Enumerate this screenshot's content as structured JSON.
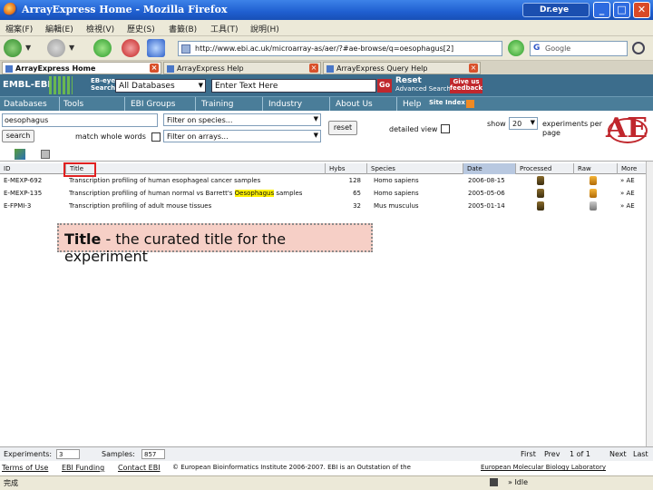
{
  "window": {
    "title": "ArrayExpress Home - Mozilla Firefox",
    "dreye_label": "Dr.eye",
    "minimize": "_",
    "maximize": "□",
    "close": "✕"
  },
  "menu": [
    "檔案(F)",
    "編輯(E)",
    "檢視(V)",
    "歷史(S)",
    "書籤(B)",
    "工具(T)",
    "說明(H)"
  ],
  "nav": {
    "url": "http://www.ebi.ac.uk/microarray-as/aer/?#ae-browse/q=oesophagus[2]",
    "search_engine_placeholder": "Google",
    "search_engine_icon": "G"
  },
  "tabs": [
    {
      "label": "ArrayExpress Home",
      "active": true
    },
    {
      "label": "ArrayExpress Help",
      "active": false
    },
    {
      "label": "ArrayExpress Query Help",
      "active": false
    }
  ],
  "ebi_header": {
    "logo": "EMBL-EBI",
    "ebeye_line1": "EB-eye",
    "ebeye_line2": "Search",
    "database_select": "All Databases",
    "free_text_placeholder": "Enter Text Here",
    "go_label": "Go",
    "reset_label": "Reset",
    "advanced_search": "Advanced Search",
    "give_feedback": "Give us feedback"
  },
  "ebi_nav": {
    "items": [
      "Databases",
      "Tools",
      "EBI Groups",
      "Training",
      "Industry",
      "About Us",
      "Help"
    ],
    "site_index": "Site Index"
  },
  "search_panel": {
    "keyword_value": "oesophagus",
    "search_button": "search",
    "match_whole_words": "match whole words",
    "species_select": "Filter on species...",
    "array_select": "Filter on arrays...",
    "reset_button": "reset",
    "detailed_view": "detailed view",
    "show_label": "show",
    "show_value": "20",
    "per_page": "experiments per page",
    "logo_text": "AE"
  },
  "table": {
    "headers": [
      "ID",
      "Title",
      "Hybs",
      "Species",
      "Date",
      "Processed",
      "Raw",
      "More"
    ],
    "sorted_column": "Date",
    "rows": [
      {
        "id": "E-MEXP-692",
        "title": "Transcription profiling of human esophageal cancer samples",
        "hybs": "128",
        "species": "Homo sapiens",
        "date": "2006-08-15",
        "raw_type": "raw",
        "more": "» AE"
      },
      {
        "id": "E-MEXP-135",
        "title_before": "Transcription profiling of human normal vs Barrett's ",
        "title_highlight": "Oesophagus",
        "title_after": " samples",
        "hybs": "65",
        "species": "Homo sapiens",
        "date": "2005-05-06",
        "raw_type": "raw",
        "more": "» AE"
      },
      {
        "id": "E-FPMI-3",
        "title": "Transcription profiling of adult mouse tissues",
        "hybs": "32",
        "species": "Mus musculus",
        "date": "2005-01-14",
        "raw_type": "raw-gray",
        "more": "» AE"
      }
    ]
  },
  "callout": {
    "term": "Title",
    "text": " - the curated title for the experiment"
  },
  "footer": {
    "experiments_label": "Experiments:",
    "experiments_value": "3",
    "samples_label": "Samples:",
    "samples_value": "857",
    "first": "First",
    "prev": "Prev",
    "page_of": "1 of 1",
    "next": "Next",
    "last": "Last"
  },
  "copyright": {
    "terms": "Terms of Use",
    "funding": "EBI Funding",
    "contact": "Contact EBI",
    "copy": "© European Bioinformatics Institute 2006-2007. EBI is an Outstation of the",
    "embl": "European Molecular Biology Laboratory"
  },
  "status": {
    "text": "完成",
    "nav": "» Idle"
  }
}
